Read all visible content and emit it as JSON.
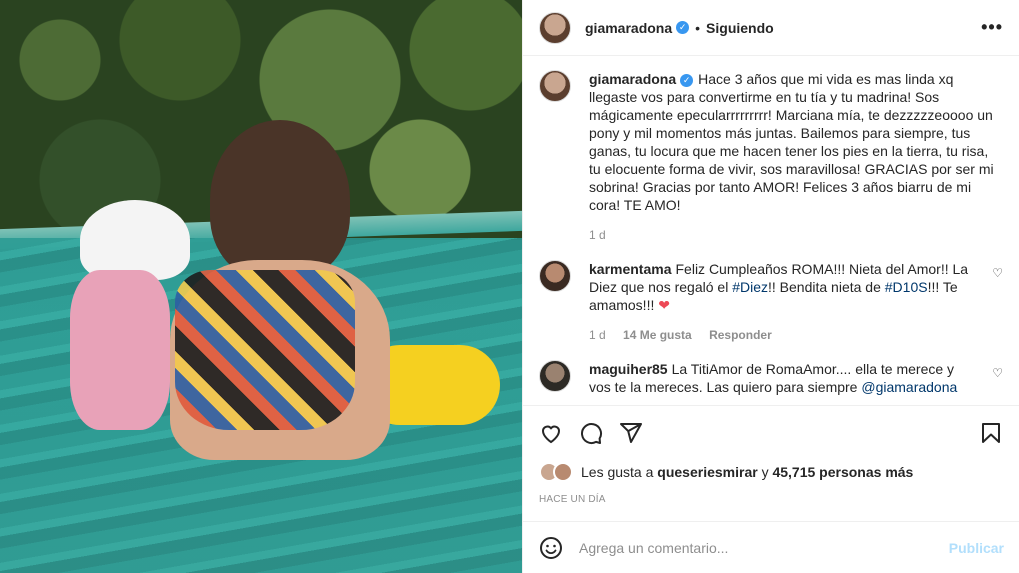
{
  "post": {
    "username": "giamaradona",
    "verified_symbol": "✓",
    "separator": "•",
    "follow_status": "Siguiendo",
    "more_icon": "more-horizontal-icon",
    "more_label": "•••"
  },
  "caption": {
    "username": "giamaradona",
    "text": "Hace 3 años que mi vida es mas linda xq llegaste vos para convertirme en tu tía y tu madrina! Sos mágicamente epecularrrrrrrrr! Marciana mía, te dezzzzzeoooo un pony y mil momentos más juntas. Bailemos para siempre, tus ganas, tu locura que me hacen tener los pies en la tierra, tu risa, tu elocuente forma de vivir, sos maravillosa! GRACIAS por ser mi sobrina! Gracias por tanto AMOR! Felices 3 años biarru de mi cora! TE AMO!",
    "time": "1 d"
  },
  "comments": [
    {
      "username": "karmentama",
      "text_a": "Feliz Cumpleaños ROMA!!! Nieta del Amor!! La Diez que nos regaló el ",
      "tag1": "#Diez",
      "text_b": "!! Bendita nieta de ",
      "tag2": "#D10S",
      "text_c": "!!! Te amamos!!! ",
      "emoji": "❤",
      "time": "1 d",
      "likes": "14 Me gusta",
      "reply": "Responder",
      "heart": "♡"
    },
    {
      "username": "maguiher85",
      "text_a": "La TitiAmor de RomaAmor.... ella te merece y vos te la mereces. Las quiero para siempre ",
      "mention": "@giamaradona",
      "heart": "♡"
    }
  ],
  "actions": {
    "like_icon": "heart-icon",
    "comment_icon": "comment-icon",
    "share_icon": "share-icon",
    "save_icon": "bookmark-icon"
  },
  "likes": {
    "prefix": "Les gusta a",
    "user": "queseriesmirar",
    "middle": "y",
    "count": "45,715 personas más"
  },
  "timestamp": "HACE UN DÍA",
  "add_comment": {
    "placeholder": "Agrega un comentario...",
    "publish": "Publicar",
    "emoji_icon": "smiley-icon"
  },
  "colors": {
    "link": "#00376b",
    "verified": "#3897f0",
    "publish": "#b2dffc",
    "heart_red": "#ed4956"
  }
}
